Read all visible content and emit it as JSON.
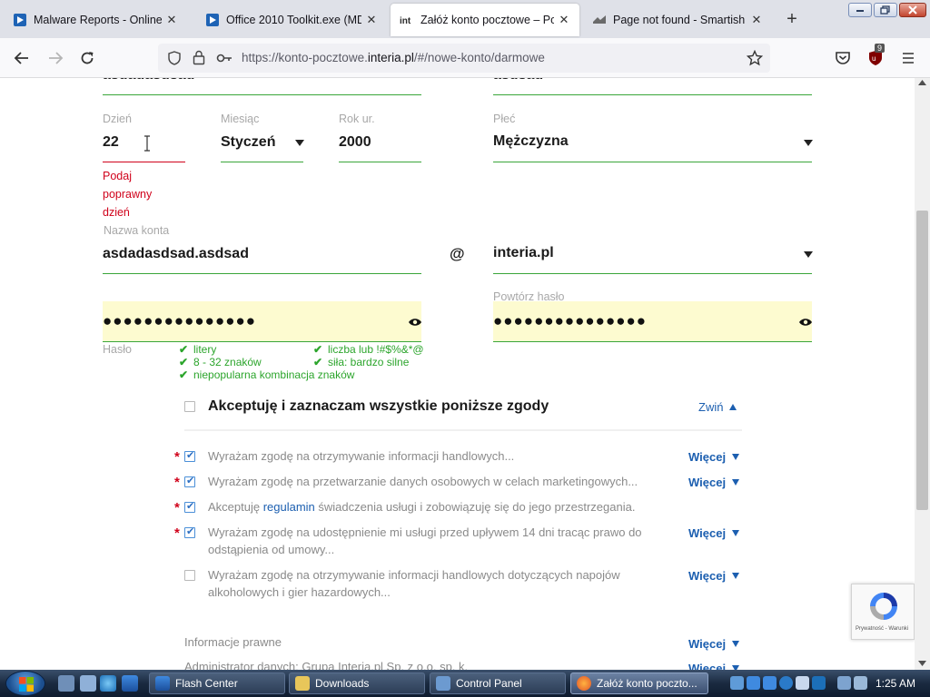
{
  "tabs": [
    {
      "title": "Malware Reports - Online Malware",
      "icon": "analysis-app-icon",
      "active": false
    },
    {
      "title": "Office 2010 Toolkit.exe (MD5: ",
      "icon": "analysis-app-icon",
      "active": false
    },
    {
      "title": "Załóż konto pocztowe – Poczta",
      "icon": "interia-icon",
      "active": true
    },
    {
      "title": "Page not found - Smartish Pages",
      "icon": "smartish-icon",
      "active": false
    }
  ],
  "tab_close_symbol": "✕",
  "new_tab_symbol": "+",
  "address": {
    "prefix": "https://konto-pocztowe.",
    "domain": "interia.pl",
    "suffix": "/#/nowe-konto/darmowe"
  },
  "extension_badge": "9",
  "form": {
    "top_left_value": "asdadasdsad",
    "top_right_value": "asdsad",
    "day": {
      "label": "Dzień",
      "value": "22",
      "error": [
        "Podaj",
        "poprawny",
        "dzień"
      ]
    },
    "month": {
      "label": "Miesiąc",
      "value": "Styczeń"
    },
    "year": {
      "label": "Rok ur.",
      "value": "2000"
    },
    "gender": {
      "label": "Płeć",
      "value": "Mężczyzna"
    },
    "account": {
      "label": "Nazwa konta",
      "value": "asdadasdsad.asdsad",
      "at": "@",
      "domain": "interia.pl"
    },
    "password": {
      "label": "Hasło",
      "dots": "●●●●●●●●●●●●●●●"
    },
    "password_repeat": {
      "label": "Powtórz hasło",
      "dots": "●●●●●●●●●●●●●●●"
    },
    "hints": [
      "litery",
      "liczba lub !#$%&*@",
      "8 - 32 znaków",
      "siła: bardzo silne",
      "niepopularna kombinacja znaków"
    ]
  },
  "consents": {
    "accept_all": "Akceptuję i zaznaczam wszystkie poniższe zgody",
    "collapse": "Zwiń",
    "more": "Więcej",
    "items": [
      {
        "text": "Wyrażam zgodę na otrzymywanie informacji handlowych...",
        "required": true,
        "checked": true
      },
      {
        "text": "Wyrażam zgodę na przetwarzanie danych osobowych w celach marketingowych...",
        "required": true,
        "checked": true
      },
      {
        "text_before": "Akceptuję ",
        "link": "regulamin",
        "text_after": " świadczenia usługi i zobowiązuję się do jego przestrzegania.",
        "required": true,
        "checked": true
      },
      {
        "text_line1": "Wyrażam zgodę na udostępnienie mi usługi przed upływem 14 dni tracąc prawo do",
        "text_line2": "odstąpienia od umowy...",
        "required": true,
        "checked": true
      },
      {
        "text_line1": "Wyrażam zgodę na otrzymywanie informacji handlowych dotyczących napojów",
        "text_line2": "alkoholowych i gier hazardowych...",
        "required": false,
        "checked": false
      }
    ],
    "legal_title": "Informacje prawne",
    "legal_text": "Administrator danych: Grupa Interia.pl Sp. z o.o. sp. k."
  },
  "recaptcha": {
    "text": "Prywatność - Warunki"
  },
  "taskbar": {
    "buttons": [
      "Flash Center",
      "Downloads",
      "Control Panel",
      "Załóż konto poczto..."
    ],
    "clock": "1:25 AM"
  }
}
